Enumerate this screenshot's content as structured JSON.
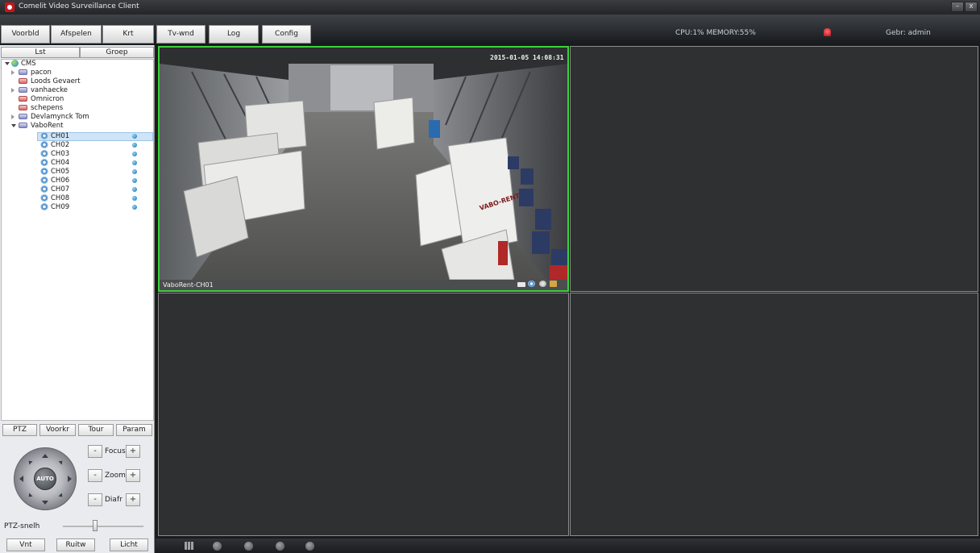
{
  "window": {
    "title": "Comelit Video Surveillance Client",
    "minimize_label": "–",
    "close_label": "x"
  },
  "menu": {
    "buttons": [
      "Voorbld",
      "Afspelen",
      "Krt",
      "Tv-wnd",
      "Log",
      "Config"
    ],
    "status_cpu_memory": "CPU:1% MEMORY:55%",
    "user": "Gebr: admin"
  },
  "left_tabs": [
    "Lst",
    "Groep"
  ],
  "tree": {
    "root": "CMS",
    "nodes": [
      {
        "label": "pacon",
        "expandable": true
      },
      {
        "label": "Loods Gevaert",
        "expandable": false
      },
      {
        "label": "vanhaecke",
        "expandable": true
      },
      {
        "label": "Omnicron",
        "expandable": false
      },
      {
        "label": "schepens",
        "expandable": false
      },
      {
        "label": "Devlamynck Tom",
        "expandable": true
      },
      {
        "label": "VaboRent",
        "expandable": true,
        "expanded": true
      }
    ],
    "channels": [
      "CH01",
      "CH02",
      "CH03",
      "CH04",
      "CH05",
      "CH06",
      "CH07",
      "CH08",
      "CH09"
    ],
    "selected_channel": "CH01"
  },
  "ptz": {
    "tabs": [
      "PTZ",
      "Voorkr",
      "Tour",
      "Param"
    ],
    "auto_label": "AUTO",
    "minus": "-",
    "plus": "+",
    "focus_label": "Focus",
    "zoom_label": "Zoom",
    "iris_label": "Diafr",
    "speed_label": "PTZ-snelh",
    "speed_level": 0.4,
    "bottom_buttons": [
      "Vnt",
      "Ruitw",
      "Licht"
    ]
  },
  "video": {
    "layout": "2x2",
    "active_pane": 1,
    "pane1_label": "VaboRent-CH01",
    "timestamp": "2015-01-05 14:08:31",
    "trailer_text": "VABO-RENT"
  },
  "colors": {
    "active_border": "#3bd23b",
    "pane_bg": "#2f3031",
    "status_dot": "#1b6aa6",
    "alarm": "#c8141b"
  },
  "toolbar_icons": [
    "layout-grid-icon",
    "snapshot-icon",
    "prev-icon",
    "next-icon",
    "stop-icon"
  ]
}
